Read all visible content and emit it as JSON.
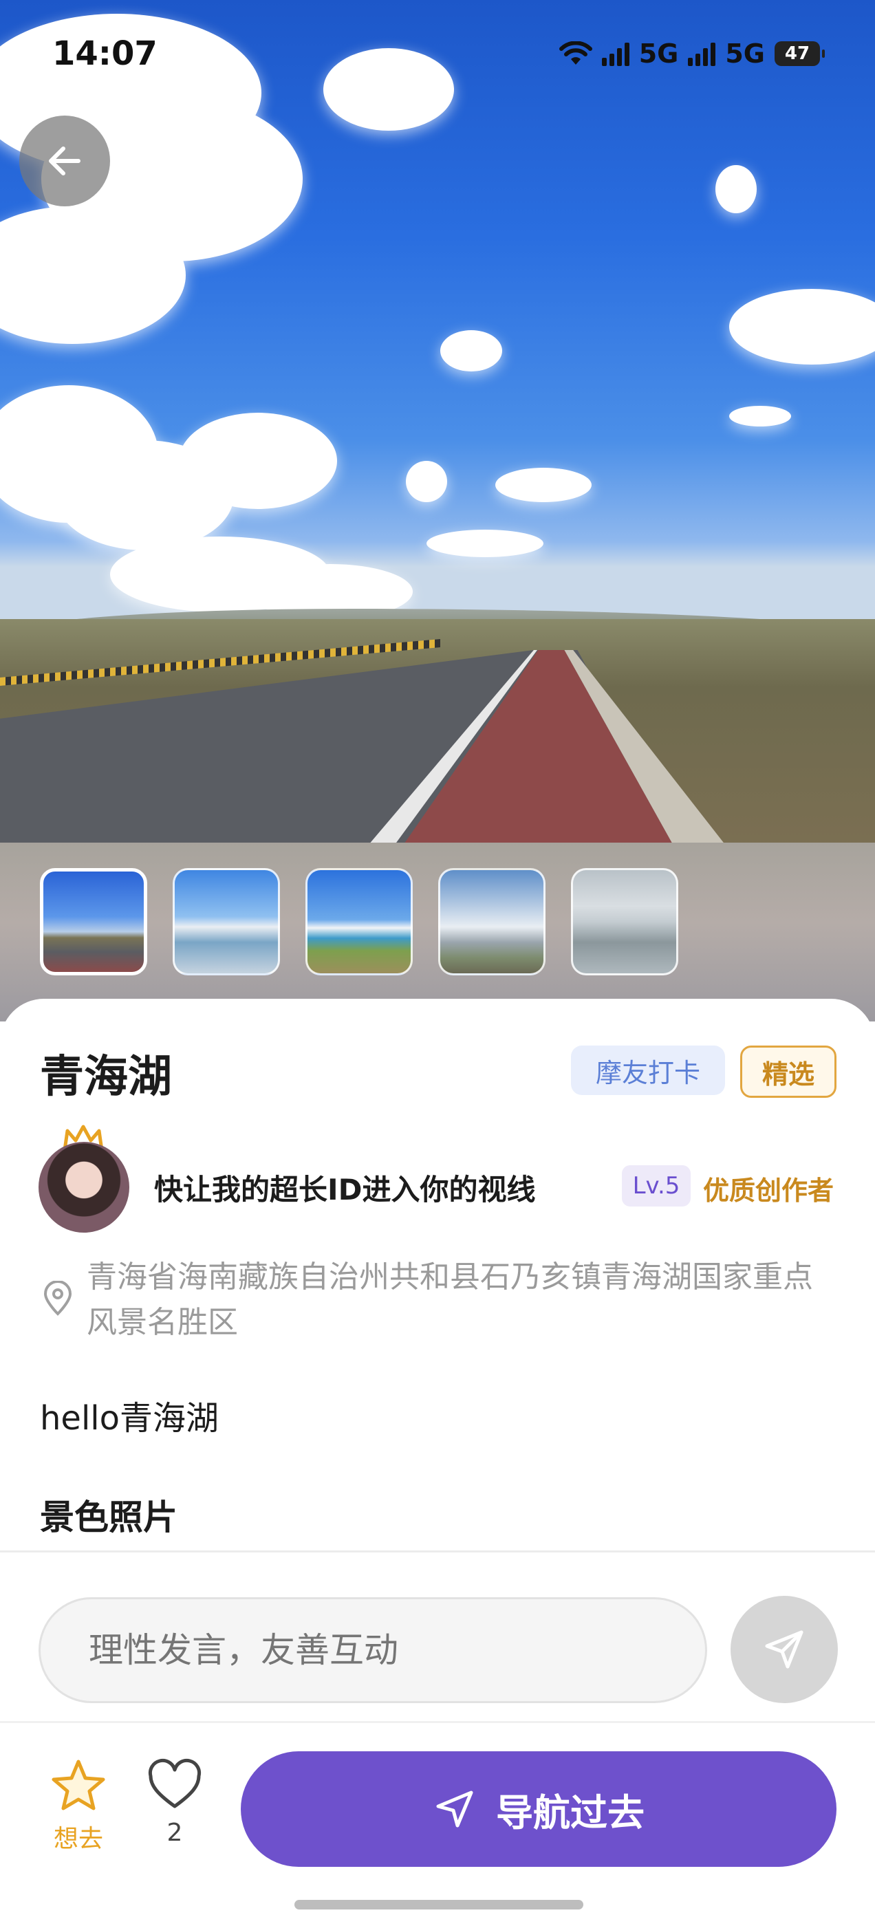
{
  "status_bar": {
    "time": "14:07",
    "network_1": "5G",
    "network_2": "5G",
    "battery": "47"
  },
  "spot": {
    "title": "青海湖",
    "tag_checkin": "摩友打卡",
    "tag_featured": "精选",
    "address": "青海省海南藏族自治州共和县石乃亥镇青海湖国家重点风景名胜区",
    "description": "hello青海湖",
    "photos_section_title": "景色照片"
  },
  "author": {
    "username": "快让我的超长ID进入你的视线",
    "level": "Lv.5",
    "badge": "优质创作者"
  },
  "thumbnails": [
    {
      "name": "thumb-road-sky",
      "selected": true
    },
    {
      "name": "thumb-lake-clouds",
      "selected": false
    },
    {
      "name": "thumb-lake-grass",
      "selected": false
    },
    {
      "name": "thumb-wetland",
      "selected": false
    },
    {
      "name": "thumb-birds",
      "selected": false
    }
  ],
  "comment": {
    "placeholder": "理性发言，友善互动"
  },
  "actions": {
    "want_label": "想去",
    "like_count": "2",
    "navigate_label": "导航过去"
  },
  "colors": {
    "primary": "#6e51cc",
    "featured_gold": "#c9891e",
    "tag_blue": "#5b7fd6",
    "star_yellow": "#e8a322"
  },
  "icons": [
    "back-arrow-icon",
    "wifi-icon",
    "signal-icon",
    "battery-icon",
    "crown-icon",
    "location-pin-icon",
    "send-icon",
    "star-icon",
    "heart-icon",
    "navigate-arrow-icon"
  ]
}
